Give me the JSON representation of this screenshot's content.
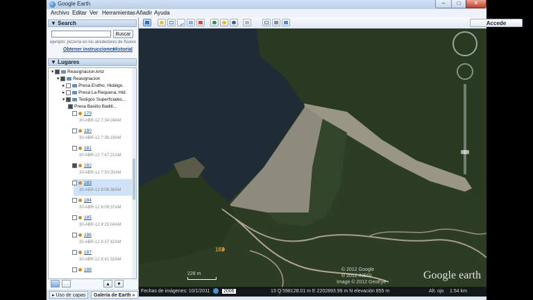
{
  "window": {
    "title": "Google Earth",
    "min_label": "–",
    "max_label": "□",
    "close_label": "✕"
  },
  "menu": [
    "Archivo",
    "Editar",
    "Ver",
    "Herramientas",
    "Añadir",
    "Ayuda"
  ],
  "toolbar": {
    "signin_label": "Accede",
    "icons": [
      "sidebar-toggle-icon",
      "placemark-icon",
      "polygon-icon",
      "path-icon",
      "overlay-icon",
      "tour-icon",
      "historical-imagery-icon",
      "sun-icon",
      "planets-icon",
      "ruler-icon",
      "email-icon",
      "print-icon",
      "view-in-maps-icon"
    ]
  },
  "search": {
    "header": "Search",
    "button_label": "Buscar",
    "hint": "ejemplo: pizzería en los alrededores de Nuevo",
    "directions_link": "Obtener instrucciones",
    "history_link": "Historial"
  },
  "places": {
    "header": "Lugares",
    "root": "Reasignacion.kmz",
    "folder": "Reasignacion",
    "items": [
      {
        "label": "Presa Endho, Hidalgo."
      },
      {
        "label": "Presa La Requena, Hid."
      },
      {
        "label": "Testigos Superficiales..."
      },
      {
        "label": "Presa Basilio Badill..."
      }
    ],
    "markers": [
      {
        "label": "179",
        "time": "30-ABR-12 7:34:24AM"
      },
      {
        "label": "180",
        "time": "30-ABR-12 7:36:19AM"
      },
      {
        "label": "181",
        "time": "30-ABR-12 7:47:21AM"
      },
      {
        "label": "182",
        "time": "30-ABR-12 7:50:20AM"
      },
      {
        "label": "183",
        "time": "30-ABR-12 8:06:38AM"
      },
      {
        "label": "184",
        "time": "30-ABR-12 8:09:37AM"
      },
      {
        "label": "185",
        "time": "30-ABR-12 8:25:04AM"
      },
      {
        "label": "186",
        "time": "30-ABR-12 8:37:42AM"
      },
      {
        "label": "187",
        "time": "30-ABR-12 8:41:32AM"
      },
      {
        "label": "188",
        "time": ""
      }
    ]
  },
  "tabs": {
    "layers": "Uso de capas",
    "gallery": "Galería de Earth",
    "gallery_suffix": "»"
  },
  "map": {
    "placemark_label": "182",
    "logo": "Google earth",
    "copyright_lines": [
      "© 2012 Google",
      "© 2012 INEGI",
      "Image © 2012 GeoEye"
    ],
    "scale_label": "228 m",
    "colors": {
      "water": "#1f2c36",
      "forest": "#2d3d25",
      "dam": "#8f8a7e"
    }
  },
  "status": {
    "imagery_date": "Fechas de imágenes: 10/1/2011",
    "year": "2006",
    "coords": "13 Q 598128.01 m E 2202893.99 m N elevación 855 m",
    "eye_alt": "Alt. ojo",
    "eye_value": "1.54 km"
  }
}
